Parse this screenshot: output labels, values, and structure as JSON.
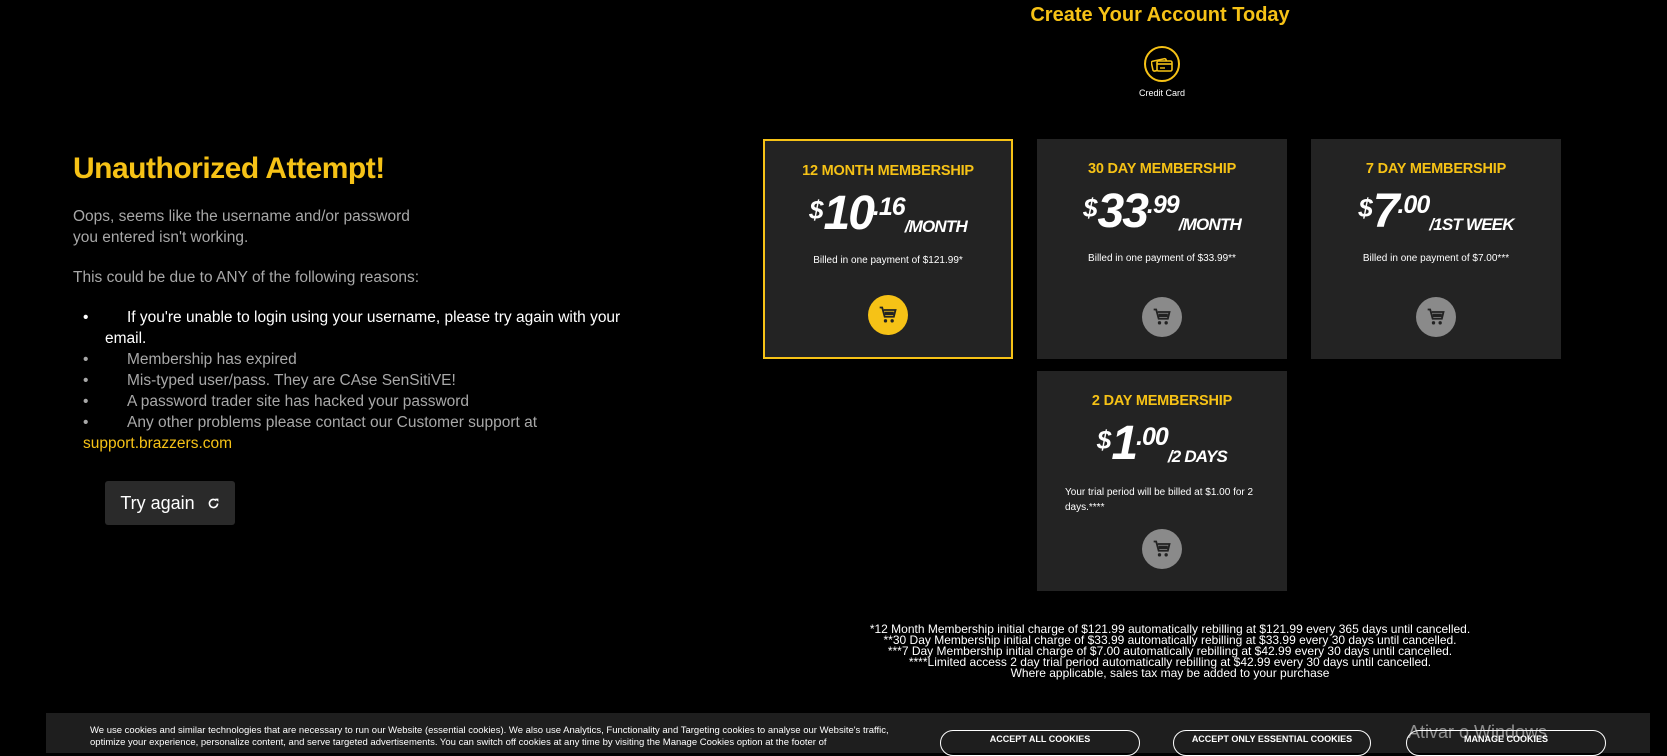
{
  "error": {
    "title": "Unauthorized Attempt!",
    "intro": "Oops, seems like the username and/or password you entered isn't working.",
    "reasons_lead": "This could be due to ANY of the following reasons:",
    "reasons": [
      "If you're unable to login using your username, please try again with your email.",
      "Membership has expired",
      "Mis-typed user/pass. They are CAse SenSitiVE!",
      "A password trader site has hacked your password",
      "Any other problems please contact our Customer support at"
    ],
    "support_link": "support.brazzers.com",
    "try_again_label": "Try again"
  },
  "signup": {
    "title": "Create Your Account Today",
    "payment_method": "Credit Card",
    "plans": [
      {
        "title": "12 MONTH MEMBERSHIP",
        "currency": "$",
        "int": "10",
        "dec": ".16",
        "period": "/MONTH",
        "billing": "Billed in one payment of $121.99*",
        "selected": true
      },
      {
        "title": "30 DAY MEMBERSHIP",
        "currency": "$",
        "int": "33",
        "dec": ".99",
        "period": "/MONTH",
        "billing": "Billed in one payment of $33.99**",
        "selected": false
      },
      {
        "title": "7 DAY MEMBERSHIP",
        "currency": "$",
        "int": "7",
        "dec": ".00",
        "period": "/1ST WEEK",
        "billing": "Billed in one payment of $7.00***",
        "selected": false
      },
      {
        "title": "2 DAY MEMBERSHIP",
        "currency": "$",
        "int": "1",
        "dec": ".00",
        "period": "/2 DAYS",
        "billing": "Your trial period will be billed at $1.00 for 2 days.****",
        "selected": false
      }
    ],
    "footnotes": [
      "*12 Month Membership initial charge of $121.99 automatically rebilling at $121.99 every 365 days until cancelled.",
      "**30 Day Membership initial charge of $33.99 automatically rebilling at $33.99 every 30 days until cancelled.",
      "***7 Day Membership initial charge of $7.00 automatically rebilling at $42.99 every 30 days until cancelled.",
      "****Limited access 2 day trial period automatically rebilling at $42.99 every 30 days until cancelled.",
      "Where applicable, sales tax may be added to your purchase"
    ]
  },
  "cookie_banner": {
    "text": "We use cookies and similar technologies that are necessary to run our Website (essential cookies). We also use Analytics, Functionality and Targeting cookies to analyse our Website's traffic, optimize your experience, personalize content, and serve targeted advertisements. You can switch off cookies at any time by visiting the Manage Cookies option at the footer of",
    "accept_all": "ACCEPT ALL COOKIES",
    "accept_essential": "ACCEPT ONLY ESSENTIAL COOKIES",
    "manage": "MANAGE COOKIES"
  },
  "watermark": "Ativar o Windows",
  "colors": {
    "accent": "#f6c216",
    "card_bg": "#232323",
    "cart_inactive": "#8a8a8a"
  }
}
